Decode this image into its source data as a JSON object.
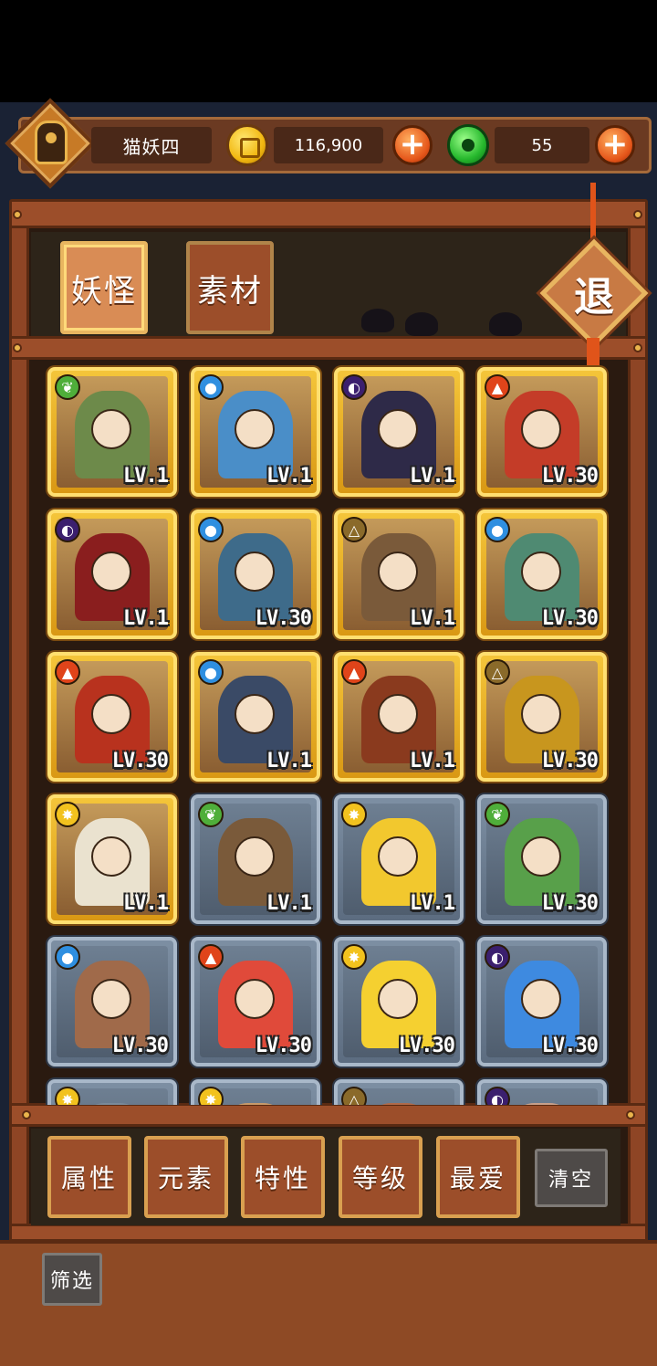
{
  "player": {
    "name": "猫妖四"
  },
  "currency": {
    "coins": "116,900",
    "jade": "55",
    "plus_label": "+"
  },
  "tabs": [
    {
      "label": "妖怪",
      "active": true
    },
    {
      "label": "素材",
      "active": false
    }
  ],
  "exit_label": "退",
  "grid": {
    "cards": [
      {
        "frame": "gold",
        "element": "wood",
        "level": "LV.1",
        "color": "#6d8a4a"
      },
      {
        "frame": "gold",
        "element": "water",
        "level": "LV.1",
        "color": "#4a8ec8"
      },
      {
        "frame": "gold",
        "element": "dark",
        "level": "LV.1",
        "color": "#2e2a48"
      },
      {
        "frame": "gold",
        "element": "fire",
        "level": "LV.30",
        "color": "#c43c28"
      },
      {
        "frame": "gold",
        "element": "dark",
        "level": "LV.1",
        "color": "#8a1e1e"
      },
      {
        "frame": "gold",
        "element": "water",
        "level": "LV.30",
        "color": "#3e6b8a"
      },
      {
        "frame": "gold",
        "element": "earth",
        "level": "LV.1",
        "color": "#7a5a3a"
      },
      {
        "frame": "gold",
        "element": "water",
        "level": "LV.30",
        "color": "#4f8a72"
      },
      {
        "frame": "gold",
        "element": "fire",
        "level": "LV.30",
        "color": "#b8321e"
      },
      {
        "frame": "gold",
        "element": "water",
        "level": "LV.1",
        "color": "#3a4a66"
      },
      {
        "frame": "gold",
        "element": "fire",
        "level": "LV.1",
        "color": "#8a3a1e"
      },
      {
        "frame": "gold",
        "element": "earth",
        "level": "LV.30",
        "color": "#c8961e"
      },
      {
        "frame": "gold",
        "element": "light",
        "level": "LV.1",
        "color": "#eae2cf"
      },
      {
        "frame": "steel",
        "element": "wood",
        "level": "LV.1",
        "color": "#7a5a3a"
      },
      {
        "frame": "steel",
        "element": "light",
        "level": "LV.1",
        "color": "#f2c82e"
      },
      {
        "frame": "steel",
        "element": "wood",
        "level": "LV.30",
        "color": "#58a04a"
      },
      {
        "frame": "steel",
        "element": "water",
        "level": "LV.30",
        "color": "#a06a4a"
      },
      {
        "frame": "steel",
        "element": "fire",
        "level": "LV.30",
        "color": "#e04a3a"
      },
      {
        "frame": "steel",
        "element": "light",
        "level": "LV.30",
        "color": "#f5d030"
      },
      {
        "frame": "steel",
        "element": "dark",
        "level": "LV.30",
        "color": "#3e8ae0"
      },
      {
        "frame": "steel",
        "element": "light",
        "level": "",
        "color": "#7a8a9a"
      },
      {
        "frame": "steel",
        "element": "light",
        "level": "",
        "color": "#c89a6a"
      },
      {
        "frame": "steel",
        "element": "earth",
        "level": "",
        "color": "#b06a4a"
      },
      {
        "frame": "steel",
        "element": "dark",
        "level": "",
        "color": "#c8a08a"
      }
    ]
  },
  "filters": [
    {
      "label": "属性"
    },
    {
      "label": "元素"
    },
    {
      "label": "特性"
    },
    {
      "label": "等级"
    },
    {
      "label": "最爱"
    }
  ],
  "clear_label": "清空",
  "screen_label": "筛选",
  "colors": {
    "wood": "#4fae3a",
    "water": "#2f8fe0",
    "dark": "#3b1f6e",
    "fire": "#e0441a",
    "earth": "#8a6a2a",
    "light": "#f2c21e"
  }
}
